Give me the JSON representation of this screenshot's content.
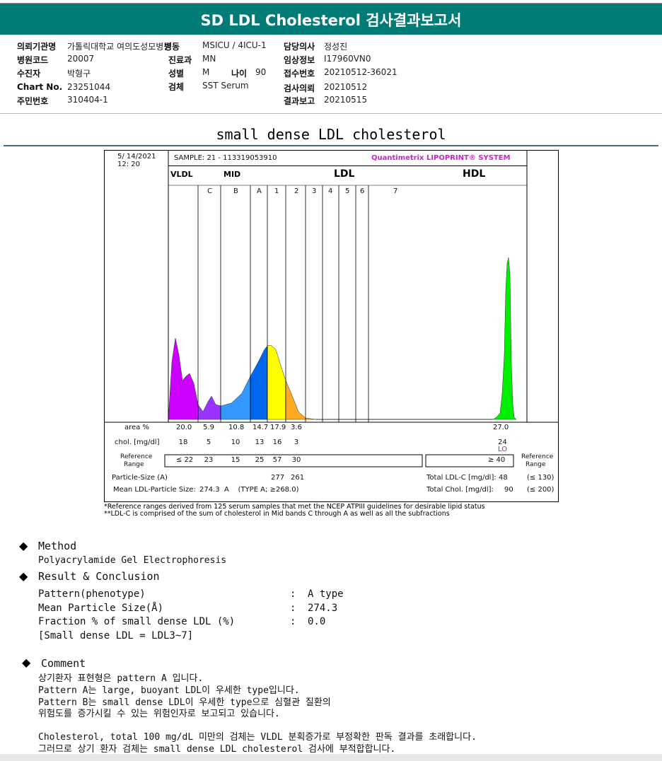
{
  "header": {
    "title": "SD LDL Cholesterol 검사결과보고서"
  },
  "info": {
    "institution_label": "의뢰기관명",
    "institution": "가톨릭대학교 여의도성모병원",
    "ward_label": "병동",
    "ward": "MSICU / 4ICU-1",
    "doctor_label": "담당의사",
    "doctor": "정성진",
    "hospital_code_label": "병원코드",
    "hospital_code": "20007",
    "dept_label": "진료과",
    "dept": "MN",
    "clinical_label": "임상정보",
    "clinical": "I17960VN0",
    "patient_label": "수진자",
    "patient": "박형구",
    "sex_label": "성별",
    "sex": "M",
    "age_label": "나이",
    "age": "90",
    "accession_label": "접수번호",
    "accession": "20210512-36021",
    "chart_label": "Chart No.",
    "chart_no": "23251044",
    "specimen_label": "검체",
    "specimen": "SST Serum",
    "request_label": "검사의뢰",
    "request_date": "20210512",
    "id_label": "주민번호",
    "id_no": "310404-1",
    "report_label": "결과보고",
    "report_date": "20210515"
  },
  "subtitle": "small dense LDL cholesterol",
  "chart_data": {
    "type": "area",
    "date": "5/ 14/2021",
    "time": "12: 20",
    "sample": "SAMPLE:   21 - 113319053910",
    "brand": "Quantimetrix LIPOPRINT® SYSTEM",
    "groups": [
      "VLDL",
      "MID",
      "LDL",
      "HDL"
    ],
    "subbands": [
      "C",
      "B",
      "A",
      "1",
      "2",
      "3",
      "4",
      "5",
      "6",
      "7"
    ],
    "rows": {
      "area_label": "area %",
      "area": [
        "20.0",
        "5.9",
        "10.8",
        "14.7",
        "17.9",
        "3.6"
      ],
      "hdl_area": "27.0",
      "chol_label": "chol. [mg/dl]",
      "chol": [
        "18",
        "5",
        "10",
        "13",
        "16",
        "3"
      ],
      "hdl_chol": "24",
      "hdl_flag": "LO",
      "ref_label1": "Reference",
      "ref_label2": "Range",
      "ref": [
        "≤ 22",
        "23",
        "15",
        "25",
        "57",
        "30"
      ],
      "hdl_ref": "≥ 40",
      "particle_label": "Particle-Size (A)",
      "particle": [
        "277",
        "261"
      ],
      "mean_label": "Mean LDL-Particle Size:",
      "mean": "274.3  A    (TYPE A; ≥268.0)",
      "total_ldl_label": "Total LDL-C [mg/dl]:",
      "total_ldl": "48",
      "total_ldl_ref": "(≤ 130)",
      "total_chol_label": "Total Chol. [mg/dl]:",
      "total_chol": "90",
      "total_chol_ref": "(≤ 200)"
    },
    "footnote1": "*Reference ranges derived from 125 serum samples that met the NCEP ATPIII guidelines for desirable lipid status",
    "footnote2": "**LDL-C is comprised of the sum of cholesterol in Mid bands C through A as well as all the subfractions",
    "colors": [
      "#cc00ff",
      "#9933ff",
      "#3399ff",
      "#0066ee",
      "#ffff00",
      "#ffaa22",
      "#00ee00"
    ]
  },
  "method": {
    "title": "Method",
    "text": "Polyacrylamide Gel Electrophoresis"
  },
  "result": {
    "title": "Result & Conclusion",
    "items": [
      {
        "k": "Pattern(phenotype)",
        "v": "A type"
      },
      {
        "k": "Mean Particle Size(Å)",
        "v": "274.3"
      },
      {
        "k": "Fraction % of small dense LDL (%)",
        "v": "0.0"
      }
    ],
    "sep": ":",
    "note": "[Small dense LDL = LDL3~7]"
  },
  "comment": {
    "title": "Comment",
    "lines": [
      "상기환자 표현형은 pattern A 입니다.",
      "Pattern A는 large, buoyant LDL이 우세한 type입니다.",
      "Pattern B는 small dense LDL이 우세한 type으로 심혈관 질환의",
      "위험도를 증가시킬 수 있는 위험인자로 보고되고 있습니다.",
      "Cholesterol, total 100 mg/dL 미만의 검체는 VLDL 분획증가로 부정확한 판독 결과를 초래합니다.",
      "그러므로 상기 환자 검체는 small dense LDL cholesterol 검사에 부적합합니다."
    ]
  }
}
